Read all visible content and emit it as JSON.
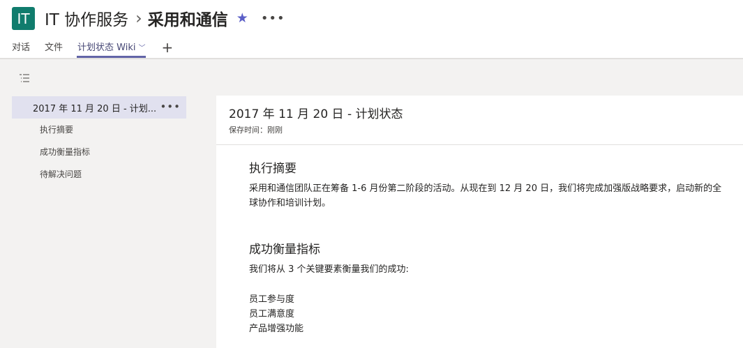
{
  "header": {
    "avatar_text": "IT",
    "team_name": "IT 协作服务",
    "separator": "›",
    "channel_name": "采用和通信",
    "favorite_icon": "star-icon",
    "more_icon": "more-icon"
  },
  "tabs": [
    {
      "label": "对话"
    },
    {
      "label": "文件"
    },
    {
      "label": "计划状态 Wiki",
      "active": true
    }
  ],
  "tab_add": "+",
  "colors": {
    "avatar_bg": "#107c6d",
    "accent": "#6264a7",
    "selected_item_bg": "#e1e1ef"
  },
  "sidebar": {
    "page": {
      "label": "2017 年 11 月 20 日 - 计划...",
      "more": "•••"
    },
    "sections": [
      {
        "label": "执行摘要"
      },
      {
        "label": "成功衡量指标"
      },
      {
        "label": "待解决问题"
      }
    ]
  },
  "content": {
    "title": "2017 年 11 月 20 日 - 计划状态",
    "save_status": "保存时间：刚刚",
    "sections": [
      {
        "heading": "执行摘要",
        "text": "采用和通信团队正在筹备 1-6 月份第二阶段的活动。从现在到 12 月 20 日，我们将完成加强版战略要求，启动新的全球协作和培训计划。"
      },
      {
        "heading": "成功衡量指标",
        "text": "我们将从 3 个关键要素衡量我们的成功:",
        "list": [
          "员工参与度",
          "员工满意度",
          "产品增强功能"
        ]
      }
    ]
  }
}
